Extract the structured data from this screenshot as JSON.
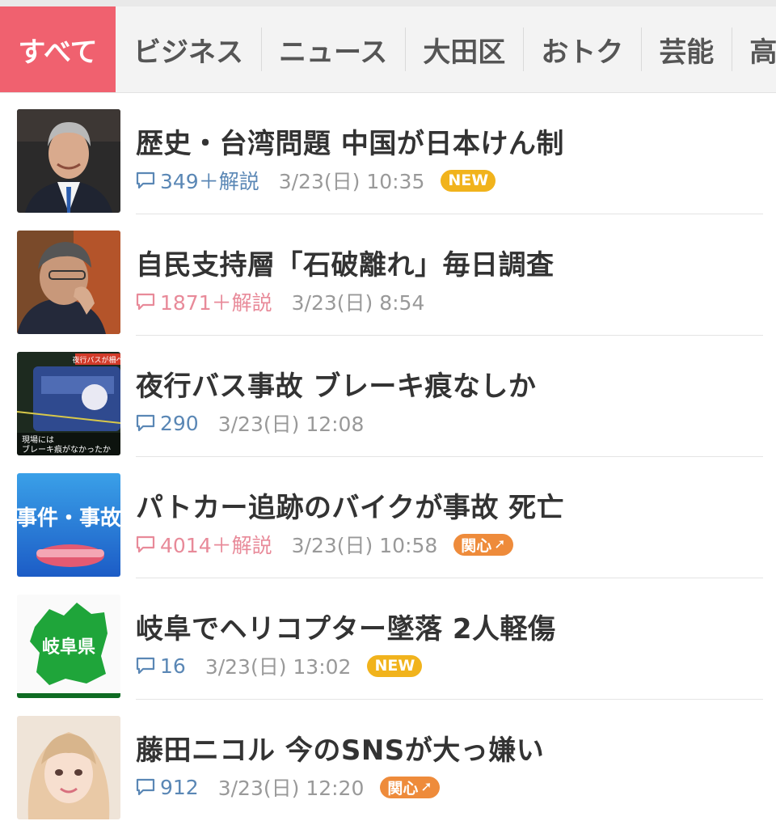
{
  "tabs": [
    {
      "label": "すべて"
    },
    {
      "label": "ビジネス"
    },
    {
      "label": "ニュース"
    },
    {
      "label": "大田区"
    },
    {
      "label": "おトク"
    },
    {
      "label": "芸能"
    },
    {
      "label": "高杉"
    }
  ],
  "articles": [
    {
      "title": "歴史・台湾問題 中国が日本けん制",
      "comments": "349＋解説",
      "time": "3/23(日) 10:35",
      "badge": "NEW",
      "comment_color": "blue"
    },
    {
      "title": "自民支持層「石破離れ」毎日調査",
      "comments": "1871＋解説",
      "time": "3/23(日) 8:54",
      "badge": "",
      "comment_color": "pink"
    },
    {
      "title": "夜行バス事故 ブレーキ痕なしか",
      "comments": "290",
      "time": "3/23(日) 12:08",
      "badge": "",
      "comment_color": "blue",
      "thumb_caption_1": "現場には",
      "thumb_caption_2": "ブレーキ痕がなかったか",
      "thumb_banner": "夜行バスが柵へ"
    },
    {
      "title": "パトカー追跡のバイクが事故 死亡",
      "comments": "4014＋解説",
      "time": "3/23(日) 10:58",
      "badge": "関心",
      "comment_color": "pink",
      "thumb_text": "事件・事故"
    },
    {
      "title": "岐阜でヘリコプター墜落 2人軽傷",
      "comments": "16",
      "time": "3/23(日) 13:02",
      "badge": "NEW",
      "comment_color": "blue",
      "thumb_text": "岐阜県"
    },
    {
      "title": "藤田ニコル 今のSNSが大っ嫌い",
      "comments": "912",
      "time": "3/23(日) 12:20",
      "badge": "関心",
      "comment_color": "blue"
    }
  ]
}
